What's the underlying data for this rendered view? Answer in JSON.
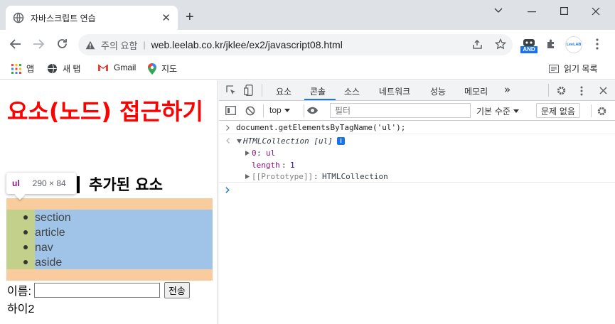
{
  "browser": {
    "tab_title": "자바스크립트 연습",
    "tab_close": "✕",
    "new_tab": "+",
    "security_label": "주의 요함",
    "url": "web.leelab.co.kr/jklee/ex2/javascript08.html",
    "ext_badge": "AND",
    "ext_leelab": "LeeLAB"
  },
  "bookmarks": [
    {
      "label": "앱"
    },
    {
      "label": "새 탭"
    },
    {
      "label": "Gmail"
    },
    {
      "label": "지도"
    }
  ],
  "reading_list": "읽기 목록",
  "page": {
    "heading": "요소(노드) 접근하기",
    "subheading": "추가된 요소",
    "tooltip_tag": "ul",
    "tooltip_dims": "290 × 84",
    "list_items": [
      "section",
      "article",
      "nav",
      "aside"
    ],
    "form_label": "이름:",
    "submit_label": "전송",
    "output": "하이2"
  },
  "devtools": {
    "tabs": [
      "요소",
      "콘솔",
      "소스",
      "네트워크",
      "성능",
      "메모리"
    ],
    "active_tab": "콘솔",
    "more_tabs": "»",
    "context": "top",
    "filter_placeholder": "필터",
    "level": "기본 수준",
    "issues": "문제 없음",
    "console": {
      "command": "document.getElementsByTagName('ul');",
      "result_type": "HTMLCollection [ul]",
      "item0_key": "0",
      "item0_val": "ul",
      "length_key": "length",
      "length_val": "1",
      "proto_key": "[[Prototype]]",
      "proto_val": "HTMLCollection"
    }
  }
}
